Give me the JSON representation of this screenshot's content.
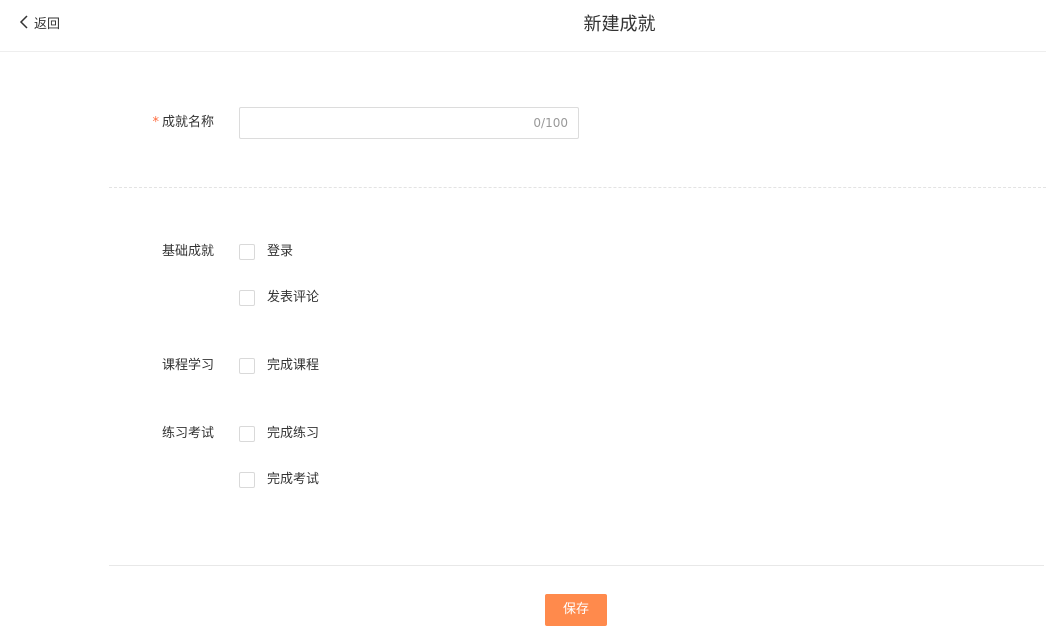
{
  "header": {
    "back_label": "返回",
    "title": "新建成就"
  },
  "form": {
    "name_label": "成就名称",
    "required_mark": "*",
    "name_value": "",
    "name_counter": "0/100",
    "groups": [
      {
        "label": "基础成就",
        "options": [
          {
            "label": "登录",
            "checked": false
          },
          {
            "label": "发表评论",
            "checked": false
          }
        ]
      },
      {
        "label": "课程学习",
        "options": [
          {
            "label": "完成课程",
            "checked": false
          }
        ]
      },
      {
        "label": "练习考试",
        "options": [
          {
            "label": "完成练习",
            "checked": false
          },
          {
            "label": "完成考试",
            "checked": false
          }
        ]
      }
    ]
  },
  "footer": {
    "save_label": "保存"
  },
  "colors": {
    "accent": "#ff8a4c",
    "required": "#ff6a3d"
  }
}
